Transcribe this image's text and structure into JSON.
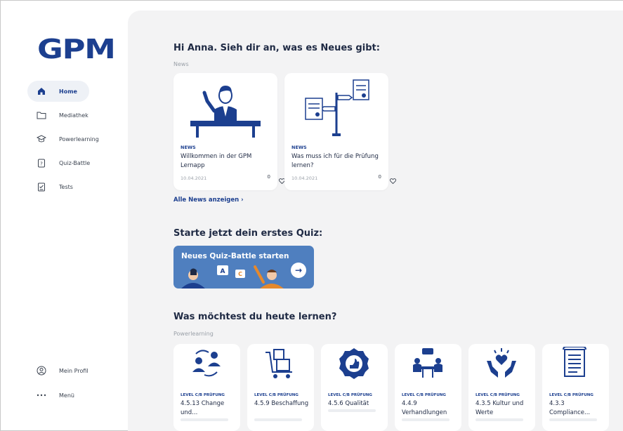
{
  "app": {
    "logo": "GPM"
  },
  "sidebar": {
    "items": [
      {
        "label": "Home",
        "icon": "home-icon",
        "active": true
      },
      {
        "label": "Mediathek",
        "icon": "folder-icon"
      },
      {
        "label": "Powerlearning",
        "icon": "graduation-cap-icon"
      },
      {
        "label": "Quiz-Battle",
        "icon": "quiz-icon"
      },
      {
        "label": "Tests",
        "icon": "test-document-icon"
      }
    ],
    "bottom": [
      {
        "label": "Mein Profil",
        "icon": "user-circle-icon"
      },
      {
        "label": "Menü",
        "icon": "more-dots-icon"
      }
    ]
  },
  "greeting": "Hi Anna. Sieh dir an, was es Neues gibt:",
  "news": {
    "section_label": "News",
    "cards": [
      {
        "tag": "NEWS",
        "title": "Willkommen in der GPM Lernapp",
        "date": "10.04.2021",
        "likes": "0",
        "illustration": "presenter-illustration"
      },
      {
        "tag": "NEWS",
        "title": "Was muss ich für die Prüfung lernen?",
        "date": "10.04.2021",
        "likes": "0",
        "illustration": "signpost-illustration"
      }
    ],
    "all_link": "Alle News anzeigen"
  },
  "quiz": {
    "heading": "Starte jetzt dein erstes Quiz:",
    "banner_label": "Neues Quiz-Battle starten"
  },
  "learn": {
    "heading": "Was möchtest du heute lernen?",
    "section_label": "Powerlearning",
    "cards": [
      {
        "tag": "LEVEL C/B PRÜFUNG",
        "title": "4.5.13 Change und...",
        "icon": "people-exchange-icon"
      },
      {
        "tag": "LEVEL C/B PRÜFUNG",
        "title": "4.5.9 Beschaffung",
        "icon": "cart-boxes-icon"
      },
      {
        "tag": "LEVEL C/B PRÜFUNG",
        "title": "4.5.6 Qualität",
        "icon": "quality-badge-icon"
      },
      {
        "tag": "LEVEL C/B PRÜFUNG",
        "title": "4.4.9 Verhandlungen",
        "icon": "negotiation-table-icon"
      },
      {
        "tag": "LEVEL C/B PRÜFUNG",
        "title": "4.3.5 Kultur und Werte",
        "icon": "hands-heart-icon"
      },
      {
        "tag": "LEVEL C/B PRÜFUNG",
        "title": "4.3.3 Compliance...",
        "icon": "document-list-icon"
      }
    ]
  },
  "colors": {
    "brand": "#1c3f8f",
    "banner": "#4f7fbf",
    "background": "#f3f3f4"
  }
}
